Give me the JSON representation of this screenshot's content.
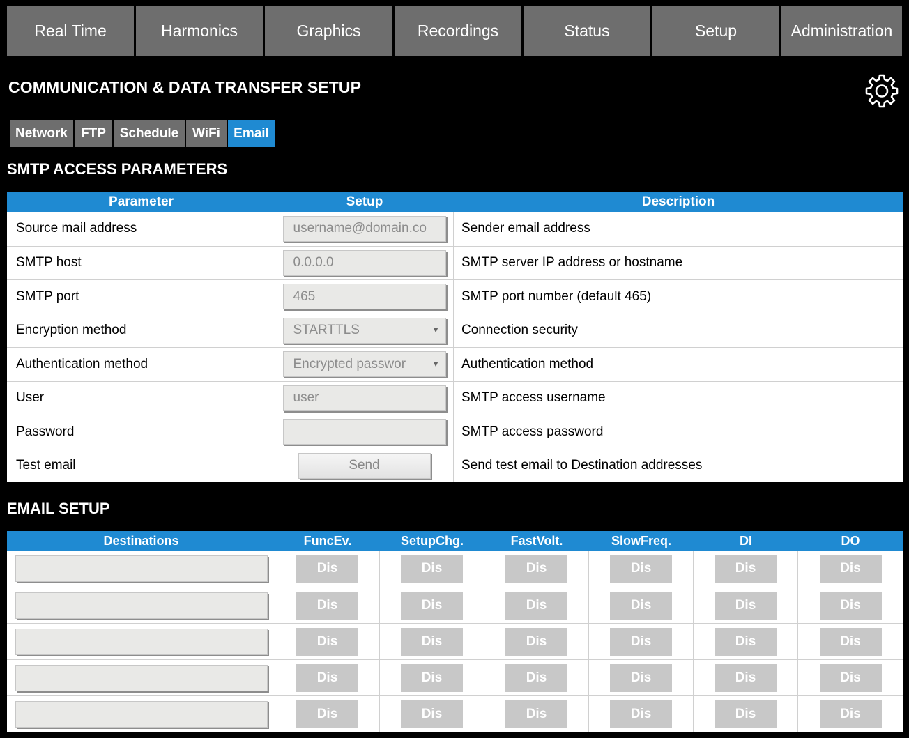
{
  "nav": [
    "Real Time",
    "Harmonics",
    "Graphics",
    "Recordings",
    "Status",
    "Setup",
    "Administration"
  ],
  "page_title": "COMMUNICATION & DATA TRANSFER SETUP",
  "settings_icon": "gear-icon",
  "subtabs": [
    "Network",
    "FTP",
    "Schedule",
    "WiFi",
    "Email"
  ],
  "active_subtab": "Email",
  "accent_color": "#1f8ad2",
  "smtp": {
    "title": "SMTP ACCESS PARAMETERS",
    "headers": [
      "Parameter",
      "Setup",
      "Description"
    ],
    "rows": [
      {
        "param": "Source mail address",
        "setup": "username@domain.co",
        "desc": "Sender email address"
      },
      {
        "param": "SMTP host",
        "setup": "0.0.0.0",
        "desc": "SMTP server IP address or hostname"
      },
      {
        "param": "SMTP port",
        "setup": "465",
        "desc": "SMTP port number (default 465)"
      },
      {
        "param": "Encryption method",
        "setup": "STARTTLS",
        "desc": "Connection security"
      },
      {
        "param": "Authentication method",
        "setup": "Encrypted passwor",
        "desc": "Authentication method"
      },
      {
        "param": "User",
        "setup": "user",
        "desc": "SMTP access username"
      },
      {
        "param": "Password",
        "setup": "",
        "desc": "SMTP access password"
      },
      {
        "param": "Test email",
        "setup": "Send",
        "desc": "Send test email to Destination addresses"
      }
    ]
  },
  "email": {
    "title": "EMAIL SETUP",
    "headers": [
      "Destinations",
      "FuncEv.",
      "SetupChg.",
      "FastVolt.",
      "SlowFreq.",
      "DI",
      "DO"
    ],
    "button_label": "Dis"
  }
}
